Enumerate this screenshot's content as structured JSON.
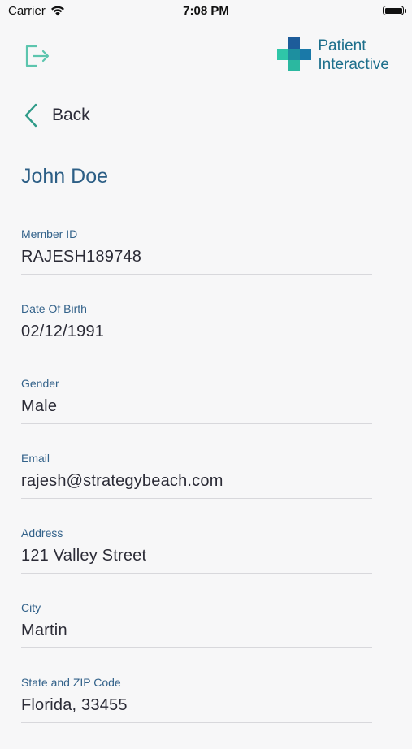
{
  "status_bar": {
    "carrier": "Carrier",
    "time": "7:08 PM"
  },
  "header": {
    "logout_icon": "logout-icon",
    "brand_line1": "Patient",
    "brand_line2": "Interactive",
    "brand_color": "#1d6f8c",
    "icon_color": "#4fc0a8"
  },
  "nav": {
    "back_label": "Back"
  },
  "patient": {
    "name": "John Doe"
  },
  "fields": [
    {
      "label": "Member ID",
      "value": "RAJESH189748"
    },
    {
      "label": "Date Of Birth",
      "value": "02/12/1991"
    },
    {
      "label": "Gender",
      "value": "Male"
    },
    {
      "label": "Email",
      "value": "rajesh@strategybeach.com"
    },
    {
      "label": "Address",
      "value": "121 Valley Street"
    },
    {
      "label": "City",
      "value": "Martin"
    },
    {
      "label": "State and ZIP Code",
      "value": "Florida, 33455"
    }
  ]
}
